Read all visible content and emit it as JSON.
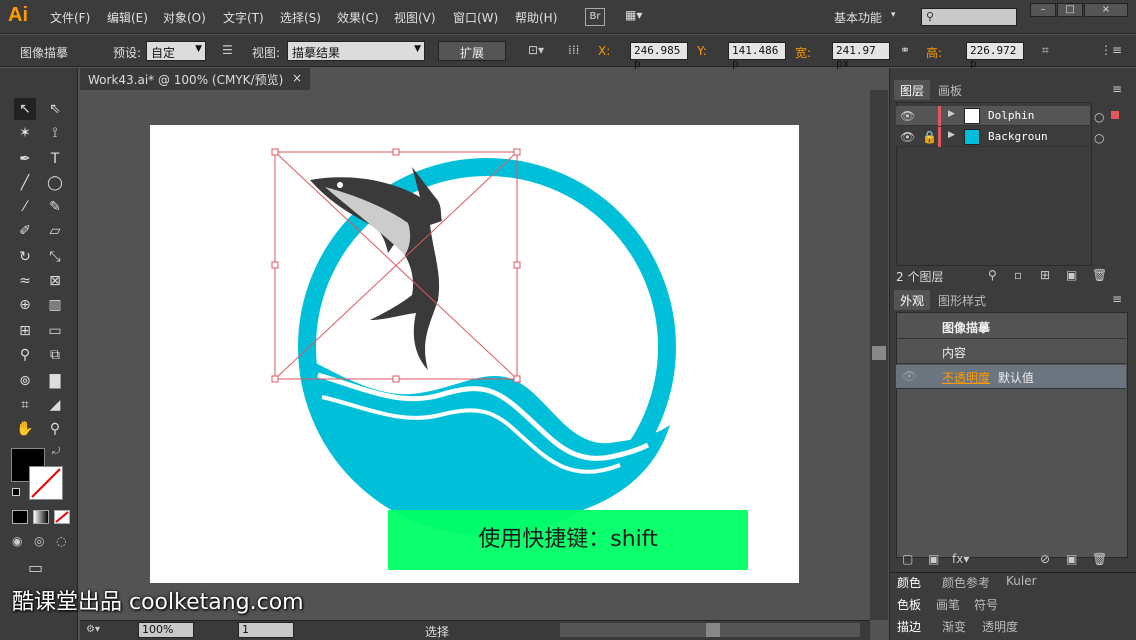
{
  "app": {
    "logo": "Ai"
  },
  "menu": [
    "文件(F)",
    "编辑(E)",
    "对象(O)",
    "文字(T)",
    "选择(S)",
    "效果(C)",
    "视图(V)",
    "窗口(W)",
    "帮助(H)"
  ],
  "menu_right": {
    "br": "Br",
    "workspace": "基本功能"
  },
  "control": {
    "panel_name": "图像描摹",
    "preset_label": "预设:",
    "preset_value": "自定",
    "view_label": "视图:",
    "view_value": "描摹结果",
    "expand": "扩展",
    "x_label": "X:",
    "x_value": "246.985 p",
    "y_label": "Y:",
    "y_value": "141.486 p",
    "w_label": "宽:",
    "w_value": "241.97 px",
    "h_label": "高:",
    "h_value": "226.972 p"
  },
  "document": {
    "tab": "Work43.ai* @ 100% (CMYK/预览)",
    "close": "×"
  },
  "status": {
    "zoom": "100%",
    "page": "1",
    "tool": "选择"
  },
  "layers": {
    "tabs": [
      "图层",
      "画板"
    ],
    "items": [
      {
        "name": "Dolphin"
      },
      {
        "name": "Backgroun"
      }
    ],
    "count": "2 个图层"
  },
  "appearance": {
    "tabs": [
      "外观",
      "图形样式"
    ],
    "title": "图像描摹",
    "content": "内容",
    "opacity_label": "不透明度",
    "opacity_value": "默认值"
  },
  "color_panels": {
    "row1": [
      "颜色",
      "颜色参考",
      "Kuler"
    ],
    "row2": [
      "色板",
      "画笔",
      "符号"
    ],
    "row3": [
      "描边",
      "渐变",
      "透明度"
    ]
  },
  "overlay": {
    "subtitle": "使用快捷键：shift",
    "watermark": "酷课堂出品 coolketang.com"
  },
  "colors": {
    "accent": "#ff9a00",
    "teal": "#00c0d9",
    "dolphin": "#3a3a3a",
    "subtitle_bg": "#00ff66"
  }
}
